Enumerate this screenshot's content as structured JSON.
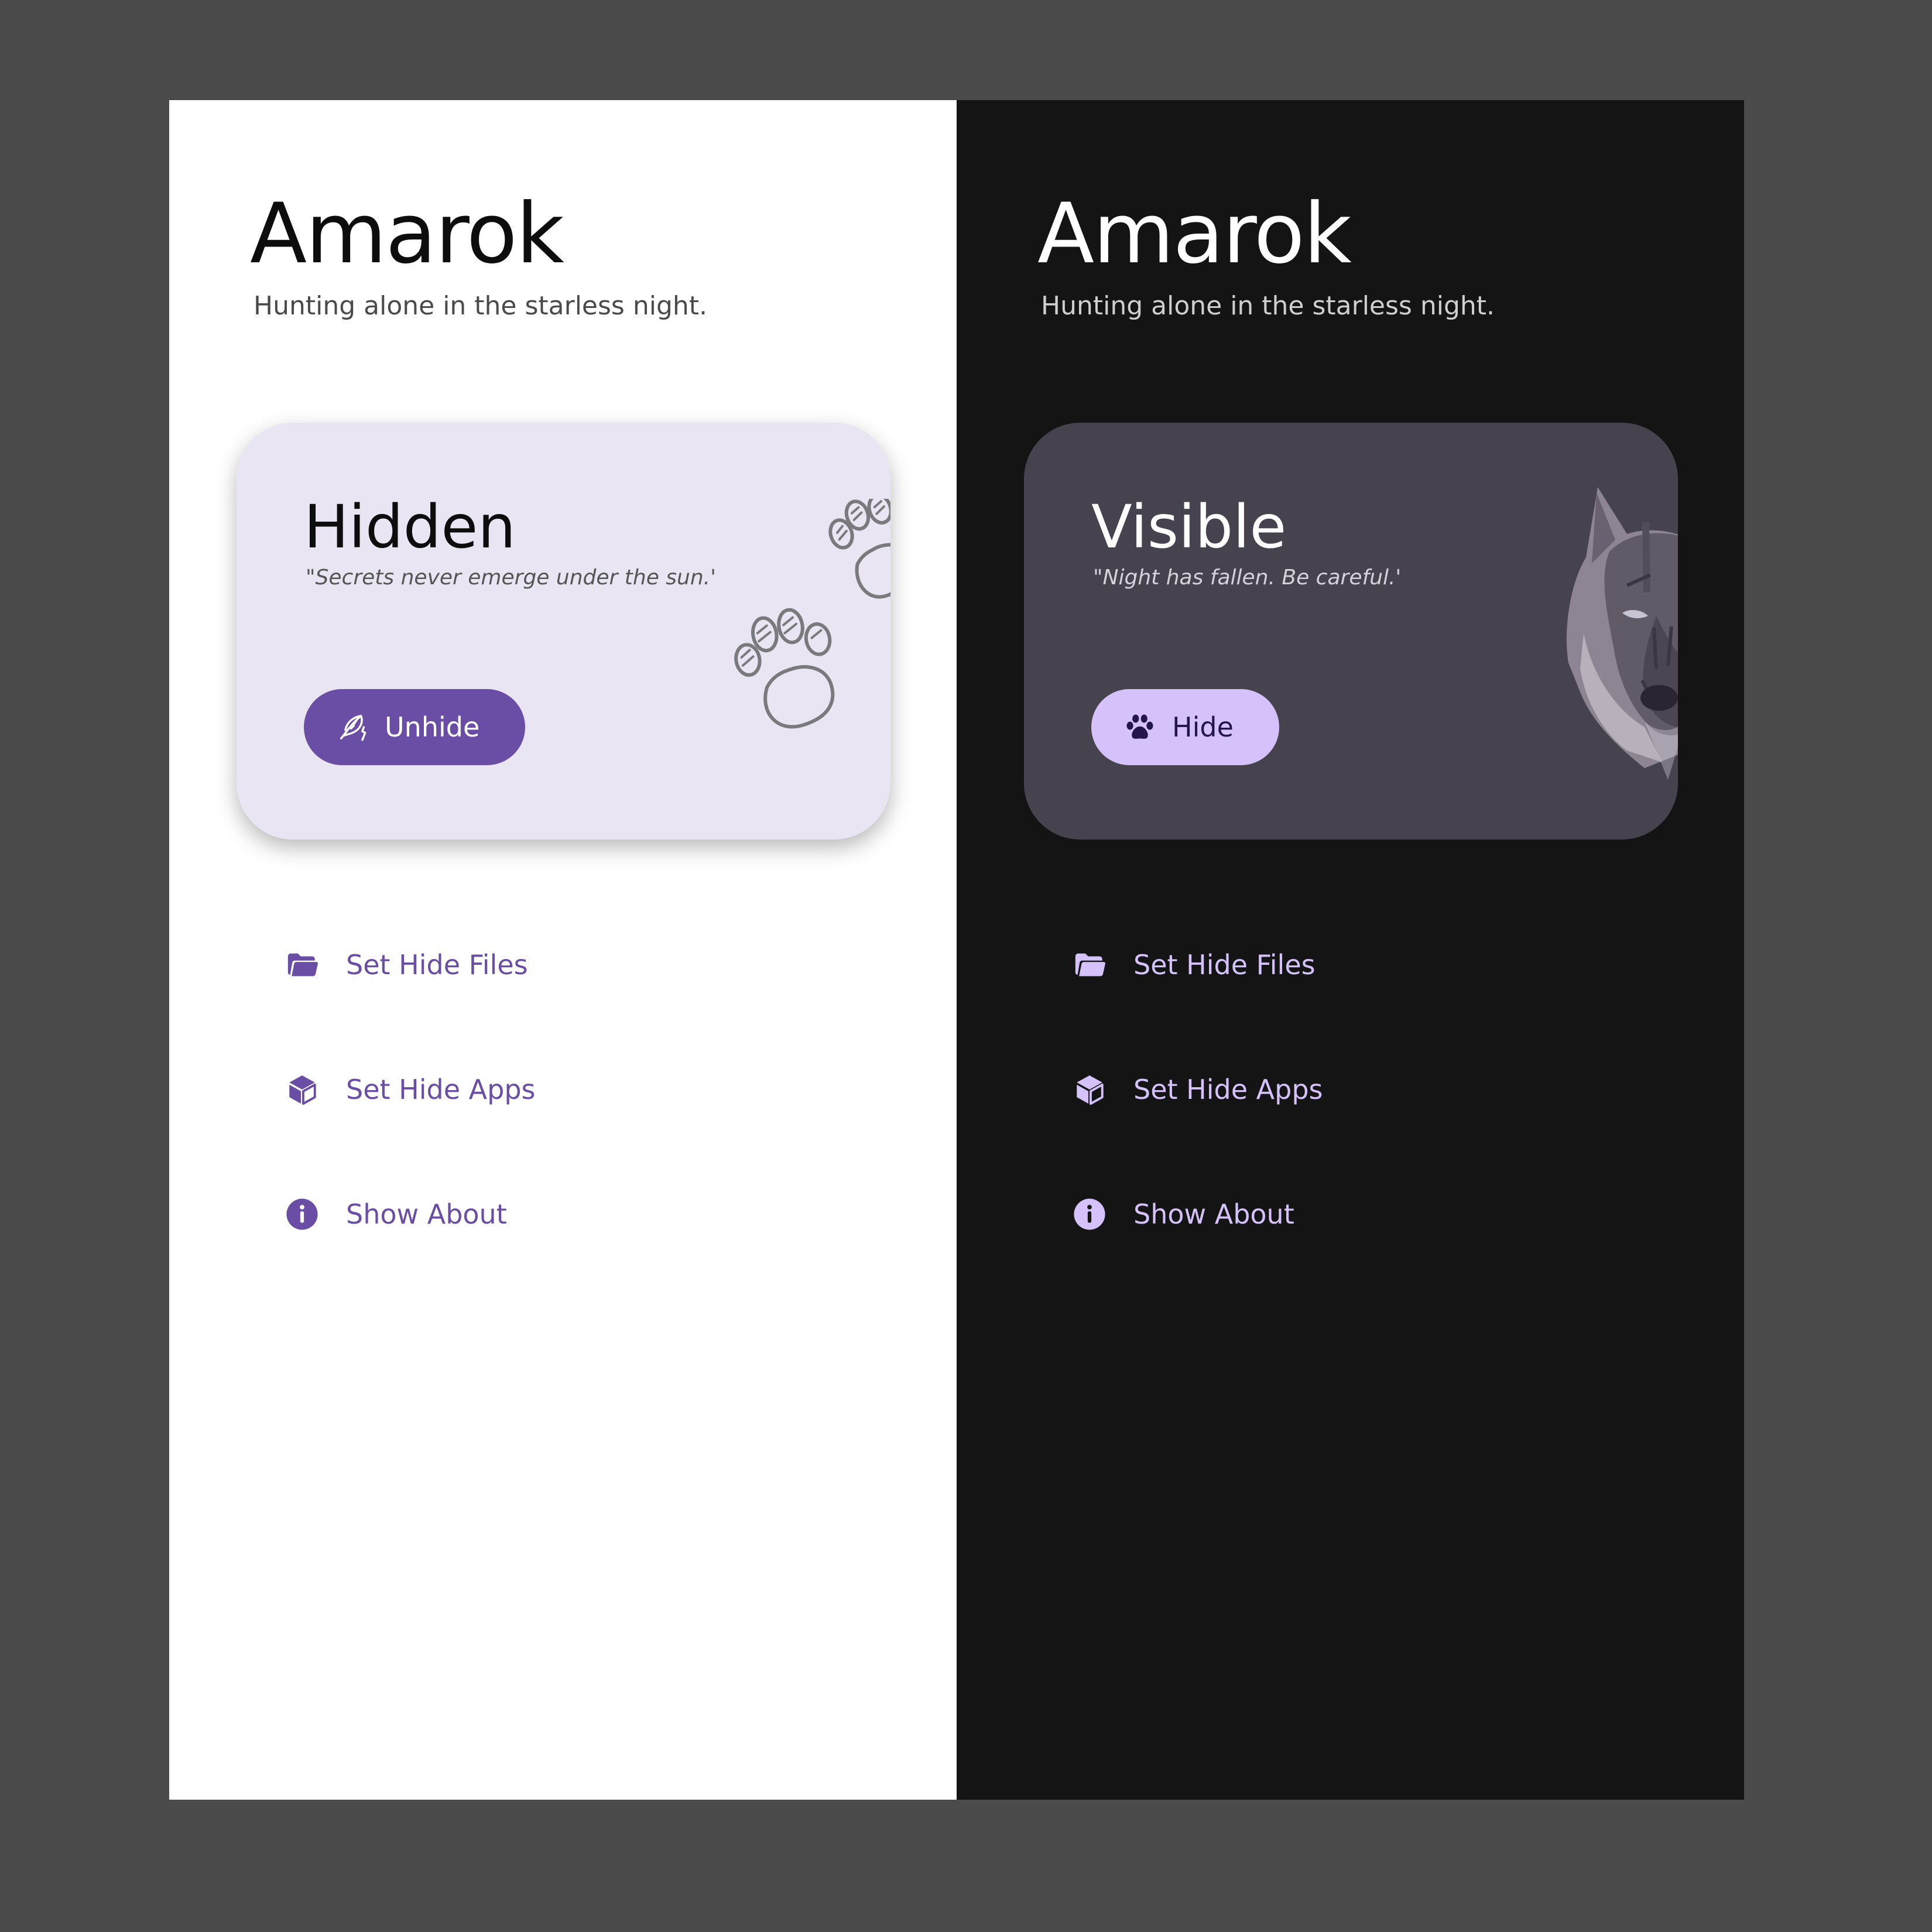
{
  "colors": {
    "background": "#4b4b4b",
    "light_surface": "#ffffff",
    "dark_surface": "#141414",
    "light_accent": "#6a4ea5",
    "dark_accent": "#d5c2fb",
    "light_card": "#e9e5f2",
    "dark_card": "#46434e"
  },
  "light": {
    "app": {
      "title": "Amarok",
      "subtitle": "Hunting alone in the starless night."
    },
    "status": {
      "title": "Hidden",
      "quote": "\"Secrets never emerge under the sun.'",
      "button_label": "Unhide",
      "button_icon": "feather-icon",
      "art": "paw-prints-icon"
    },
    "menu": [
      {
        "label": "Set Hide Files",
        "icon": "folder-icon"
      },
      {
        "label": "Set Hide Apps",
        "icon": "cube-icon"
      },
      {
        "label": "Show About",
        "icon": "info-icon"
      }
    ]
  },
  "dark": {
    "app": {
      "title": "Amarok",
      "subtitle": "Hunting alone in the starless night."
    },
    "status": {
      "title": "Visible",
      "quote": "\"Night has fallen. Be careful.'",
      "button_label": "Hide",
      "button_icon": "paw-icon",
      "art": "wolf-head-icon"
    },
    "menu": [
      {
        "label": "Set Hide Files",
        "icon": "folder-icon"
      },
      {
        "label": "Set Hide Apps",
        "icon": "cube-icon"
      },
      {
        "label": "Show About",
        "icon": "info-icon"
      }
    ]
  }
}
